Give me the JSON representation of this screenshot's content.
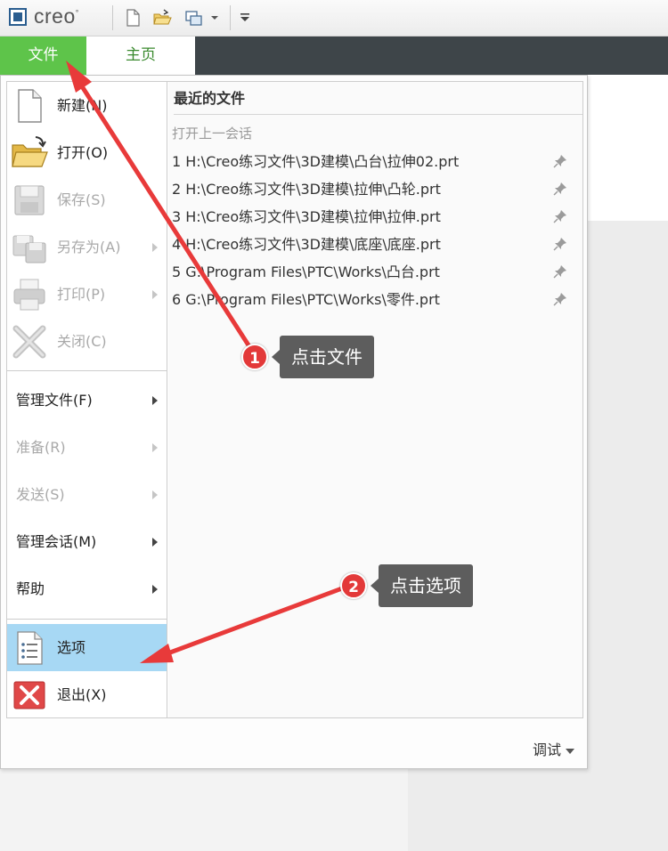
{
  "app": {
    "name": "creo",
    "mark": "°"
  },
  "tabs": {
    "file": "文件",
    "home": "主页"
  },
  "menu": {
    "new": "新建(N)",
    "open": "打开(O)",
    "save": "保存(S)",
    "save_as": "另存为(A)",
    "print": "打印(P)",
    "close": "关闭(C)",
    "manage_file": "管理文件(F)",
    "prepare": "准备(R)",
    "send": "发送(S)",
    "manage_session": "管理会话(M)",
    "help": "帮助",
    "options": "选项",
    "exit": "退出(X)"
  },
  "recent": {
    "title": "最近的文件",
    "open_last_session": "打开上一会话",
    "files": [
      "1 H:\\Creo练习文件\\3D建模\\凸台\\拉伸02.prt",
      "2 H:\\Creo练习文件\\3D建模\\拉伸\\凸轮.prt",
      "3 H:\\Creo练习文件\\3D建模\\拉伸\\拉伸.prt",
      "4 H:\\Creo练习文件\\3D建模\\底座\\底座.prt",
      "5 G:\\Program Files\\PTC\\Works\\凸台.prt",
      "6 G:\\Program Files\\PTC\\Works\\零件.prt"
    ]
  },
  "footer": {
    "debug": "调试"
  },
  "annotations": {
    "step1": {
      "number": "1",
      "text": "点击文件"
    },
    "step2": {
      "number": "2",
      "text": "点击选项"
    },
    "arrow_color": "#e83a3a"
  }
}
